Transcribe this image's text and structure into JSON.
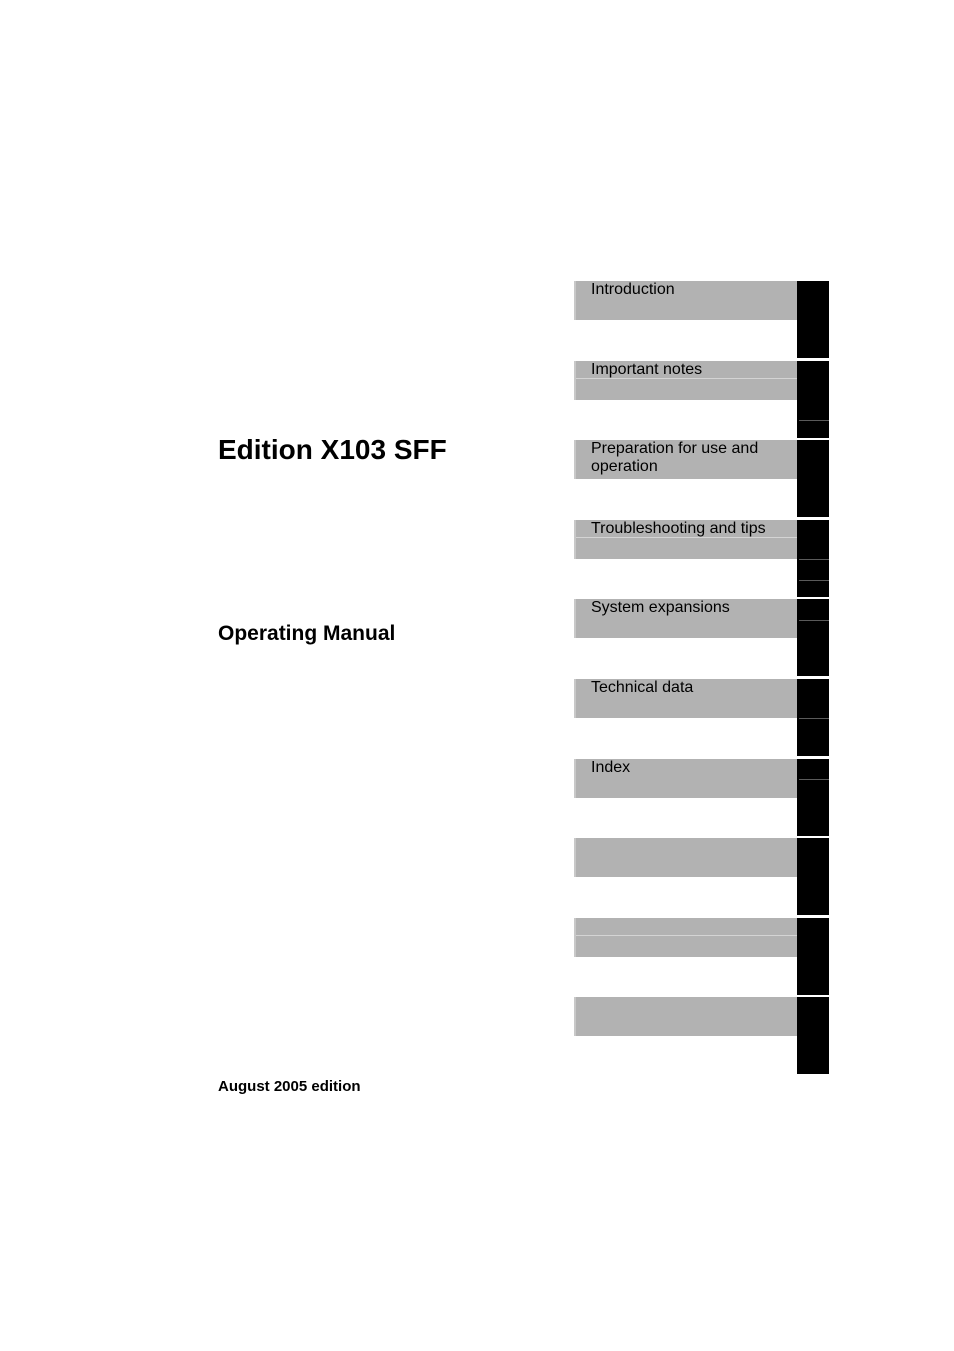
{
  "document": {
    "title": "Edition X103 SFF",
    "subtitle": "Operating Manual",
    "edition": "August 2005 edition"
  },
  "tabs": [
    {
      "label": "Introduction"
    },
    {
      "label": "Important notes"
    },
    {
      "label": "Preparation for use and operation"
    },
    {
      "label": "Troubleshooting and tips"
    },
    {
      "label": "System expansions"
    },
    {
      "label": "Technical data"
    },
    {
      "label": "Index"
    },
    {
      "label": ""
    },
    {
      "label": ""
    },
    {
      "label": ""
    }
  ],
  "colors": {
    "tab_gray": "#b2b2b2",
    "tab_black": "#000000",
    "background": "#ffffff"
  }
}
